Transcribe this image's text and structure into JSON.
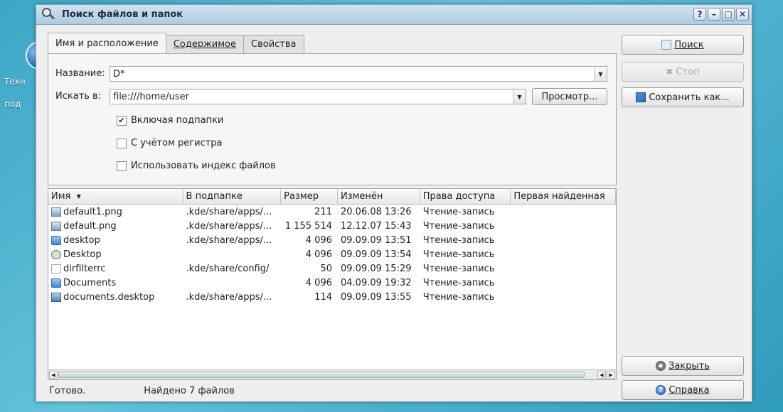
{
  "desktop": {
    "labels": [
      "Техн",
      "под"
    ]
  },
  "window": {
    "title": "Поиск файлов и папок",
    "controls": [
      "?",
      "–",
      "□",
      "✕"
    ]
  },
  "tabs": [
    {
      "label": "Имя и расположение",
      "active": true
    },
    {
      "label": "Содержимое",
      "active": false
    },
    {
      "label": "Свойства",
      "active": false
    }
  ],
  "form": {
    "name_label": "Название:",
    "name_value": "D*",
    "lookin_label": "Искать в:",
    "lookin_value": "file:///home/user",
    "browse_label": "Просмотр...",
    "include_subfolders": {
      "label": "Включая подпапки",
      "checked": true
    },
    "case_sensitive": {
      "label": "С учётом регистра",
      "checked": false
    },
    "use_index": {
      "label": "Использовать индекс файлов",
      "checked": false
    }
  },
  "table": {
    "columns": [
      "Имя",
      "В подпапке",
      "Размер",
      "Изменён",
      "Права доступа",
      "Первая найденная"
    ],
    "rows": [
      {
        "icon": "image-file-icon",
        "name": "default1.png",
        "subfolder": ".kde/share/apps/...",
        "size": "211",
        "modified": "20.06.08 13:26",
        "perms": "Чтение-запись"
      },
      {
        "icon": "image-file-icon",
        "name": "default.png",
        "subfolder": ".kde/share/apps/...",
        "size": "1 155 514",
        "modified": "12.12.07 15:43",
        "perms": "Чтение-запись"
      },
      {
        "icon": "folder-icon",
        "name": "desktop",
        "subfolder": ".kde/share/apps/...",
        "size": "4 096",
        "modified": "09.09.09 13:51",
        "perms": "Чтение-запись"
      },
      {
        "icon": "symlink-icon",
        "name": "Desktop",
        "subfolder": "",
        "size": "4 096",
        "modified": "09.09.09 13:54",
        "perms": "Чтение-запись"
      },
      {
        "icon": "text-file-icon",
        "name": "dirfilterrc",
        "subfolder": ".kde/share/config/",
        "size": "50",
        "modified": "09.09.09 15:29",
        "perms": "Чтение-запись"
      },
      {
        "icon": "folder-icon",
        "name": "Documents",
        "subfolder": "",
        "size": "4 096",
        "modified": "04.09.09 19:32",
        "perms": "Чтение-запись"
      },
      {
        "icon": "desktop-file-icon",
        "name": "documents.desktop",
        "subfolder": ".kde/share/apps/...",
        "size": "114",
        "modified": "09.09.09 13:55",
        "perms": "Чтение-запись"
      }
    ]
  },
  "status": {
    "ready": "Готово.",
    "found": "Найдено 7 файлов"
  },
  "buttons": {
    "search": "Поиск",
    "stop": "Стоп",
    "save_as": "Сохранить как...",
    "close": "Закрыть",
    "help": "Справка"
  }
}
